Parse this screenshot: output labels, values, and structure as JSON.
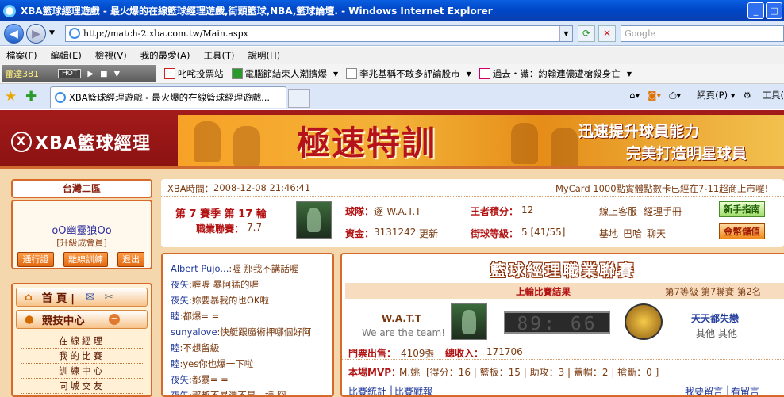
{
  "window": {
    "title": "XBA籃球經理遊戲 - 最火爆的在線籃球經理遊戲,街頭籃球,NBA,籃球論壇. - Windows Internet Explorer"
  },
  "address": {
    "url": "http://match-2.xba.com.tw/Main.aspx",
    "search_placeholder": "Google"
  },
  "menu": [
    "檔案(F)",
    "編輯(E)",
    "檢視(V)",
    "我的最愛(A)",
    "工具(T)",
    "說明(H)"
  ],
  "links": {
    "radio": "雷達381",
    "hot": "HOT",
    "items": [
      "叱咤投票站",
      "電腦節結束人潮擠爆",
      "李兆基稱不敢多評論股市",
      "過去・識：約翰連儂遭槍殺身亡"
    ]
  },
  "tab": {
    "label": "XBA籃球經理遊戲 - 最火爆的在線籃球經理遊戲..."
  },
  "tools": {
    "page": "網頁(P)",
    "tools": "工具("
  },
  "site": {
    "logo": "XBA籃球經理",
    "banner_main": "極速特訓",
    "banner_line1": "迅速提升球員能力",
    "banner_line2": "完美打造明星球員"
  },
  "left": {
    "server": "台灣二區",
    "username": "oO幽靈狼Oo",
    "level": "[升級成會員]",
    "buttons": [
      "通行證",
      "離線訓練",
      "退出"
    ],
    "nav_home": "首  頁 |",
    "nav_section": "競技中心",
    "nav_items": [
      "在線經理",
      "我的比賽",
      "訓練中心",
      "同城交友"
    ]
  },
  "info": {
    "time_label": "XBA時間：",
    "time_value": "2008-12-08 21:46:41",
    "notice": "MyCard 1000點實體點數卡已經在7-11超商上市囉!",
    "season": "第 7 賽季 第 17 輪",
    "pro_label": "職業聯賽：",
    "pro_value": "7.7",
    "team_label": "球隊：",
    "team_value": "逐-W.A.T.T",
    "king_label": "王者積分：",
    "king_value": "12",
    "service": "線上客服",
    "manual": "經理手冊",
    "newbie": "新手指南",
    "funds_label": "資金：",
    "funds_value": "3131242",
    "update": "更新",
    "street_label": "街球等級：",
    "street_value": "5 [41/55]",
    "base": "基地",
    "bar": "巴哈",
    "chat": "聊天",
    "gold": "金幣儲值"
  },
  "chat": [
    {
      "name": "Albert Pujo...",
      "text": ":喔  那我不講話喔"
    },
    {
      "name": "夜矢",
      "text": ":喔喔  暴阿猛的喔"
    },
    {
      "name": "夜矢",
      "text": ":妳要暴我的也OK啦"
    },
    {
      "name": "睦",
      "text": ":都爆= ="
    },
    {
      "name": "sunyalove",
      "text": ":快艇跟魔術押哪個好阿"
    },
    {
      "name": "睦",
      "text": ":不想留級"
    },
    {
      "name": "睦",
      "text": ":yes你也爆一下啦"
    },
    {
      "name": "夜矢",
      "text": ":都暴=   ="
    },
    {
      "name": "夜矢",
      "text": ":那都不暴還不是一樣  囧"
    }
  ],
  "match": {
    "title": "籃球經理職業聯賽",
    "last_result": "上輪比賽結果",
    "division": "第7等級  第7聯賽  第2名",
    "home_team": "W.A.T.T",
    "home_slogan": "We are the team!",
    "score": "89: 66",
    "away_team": "天天都失戀",
    "away_sub": "其他  其他",
    "tickets_label": "門票出售：",
    "tickets_value": "4109張",
    "revenue_label": "總收入：",
    "revenue_value": "171706",
    "mvp_label": "本場MVP：",
    "mvp_name": "M.姚",
    "mvp_stats": "[得分：16 | 籃板：15 | 助攻：3 | 蓋帽：2 | 搶斷：0 ]",
    "stats_link": "比賽統計",
    "review_link": "比賽戰報",
    "message_link": "我要留言",
    "view_message": "看留言"
  },
  "colors": {
    "header_red": "#a31b1b",
    "page_bg": "#f5d7ad",
    "accent_orange": "#d66a2a"
  }
}
